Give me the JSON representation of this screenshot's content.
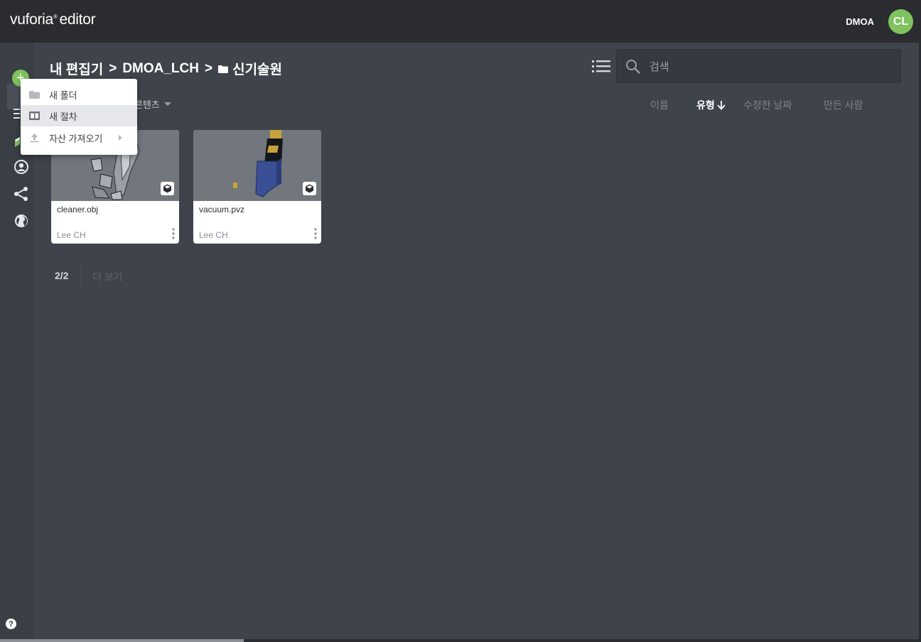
{
  "app": {
    "logo": "vuforia",
    "logo_suffix": "editor",
    "org": "DMOA",
    "avatar_initials": "CL"
  },
  "breadcrumb": {
    "root": "내 편집기",
    "sep": ">",
    "project": "DMOA_LCH",
    "folder": "신기술원"
  },
  "search": {
    "placeholder": "검색",
    "value": ""
  },
  "filter": {
    "label": "콘텐츠"
  },
  "sort": {
    "name": "이름",
    "type": "유형",
    "date": "수정한 날짜",
    "creator": "만든 사람",
    "active": "type"
  },
  "cards": [
    {
      "name": "cleaner.obj",
      "owner": "Lee CH"
    },
    {
      "name": "vacuum.pvz",
      "owner": "Lee CH"
    }
  ],
  "pager": {
    "count": "2/2",
    "more": "더 보기"
  },
  "menu": {
    "items": [
      {
        "label": "새 폴더",
        "icon": "folder-icon"
      },
      {
        "label": "새 절차",
        "icon": "procedure-icon"
      },
      {
        "label": "자산 가져오기",
        "icon": "upload-icon"
      }
    ]
  },
  "help": "?",
  "colors": {
    "accent": "#7fc25e",
    "topbar": "#2a2c2f",
    "main_bg": "#3e434c",
    "nav_bg": "#3a3e45"
  }
}
